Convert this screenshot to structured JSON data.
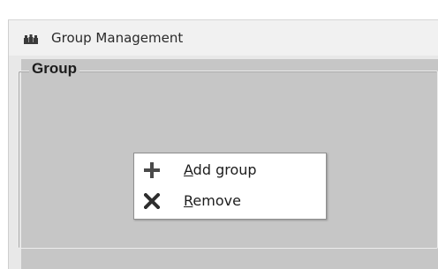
{
  "window": {
    "title": "Group Management",
    "icon": "group-people-icon"
  },
  "group": {
    "legend": "Group"
  },
  "context_menu": {
    "items": [
      {
        "icon": "plus-icon",
        "mnemonic": "A",
        "label_rest": "dd group"
      },
      {
        "icon": "x-delete-icon",
        "mnemonic": "R",
        "label_rest": "emove"
      }
    ]
  },
  "colors": {
    "client_bg": "#c6c6c6",
    "titlebar_bg": "#f1f1f1",
    "menu_bg": "#ffffff",
    "icon_dark": "#3a3a3a"
  }
}
